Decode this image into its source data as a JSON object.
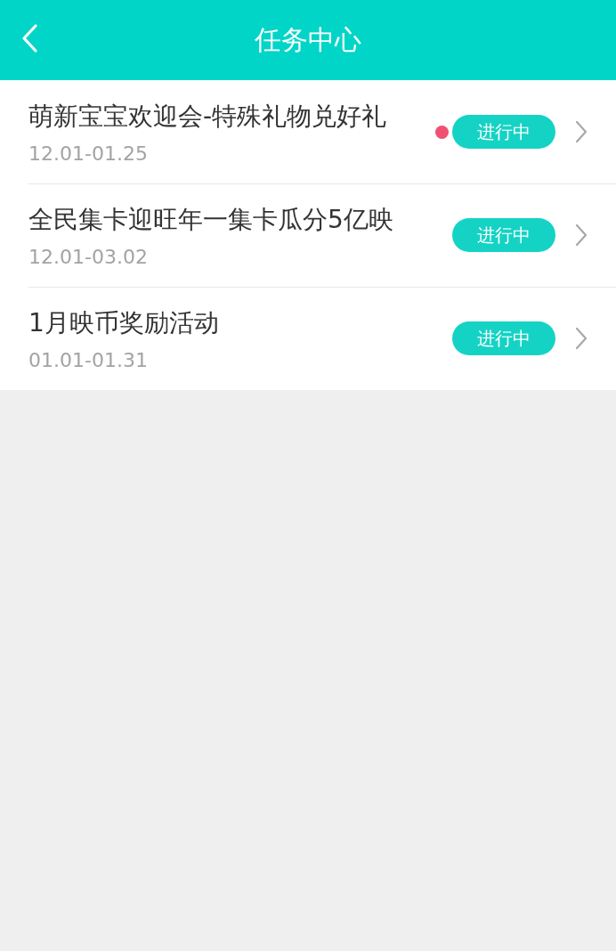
{
  "header": {
    "back": true,
    "title": "任务中心"
  },
  "tasks": [
    {
      "title": "萌新宝宝欢迎会-特殊礼物兑好礼",
      "dates": "12.01-01.25",
      "new": true,
      "status": "进行中"
    },
    {
      "title": "全民集卡迎旺年一集卡瓜分5亿映",
      "dates": "12.01-03.02",
      "new": false,
      "status": "进行中"
    },
    {
      "title": "1月映币奖励活动",
      "dates": "01.01-01.31",
      "new": false,
      "status": "进行中"
    }
  ]
}
